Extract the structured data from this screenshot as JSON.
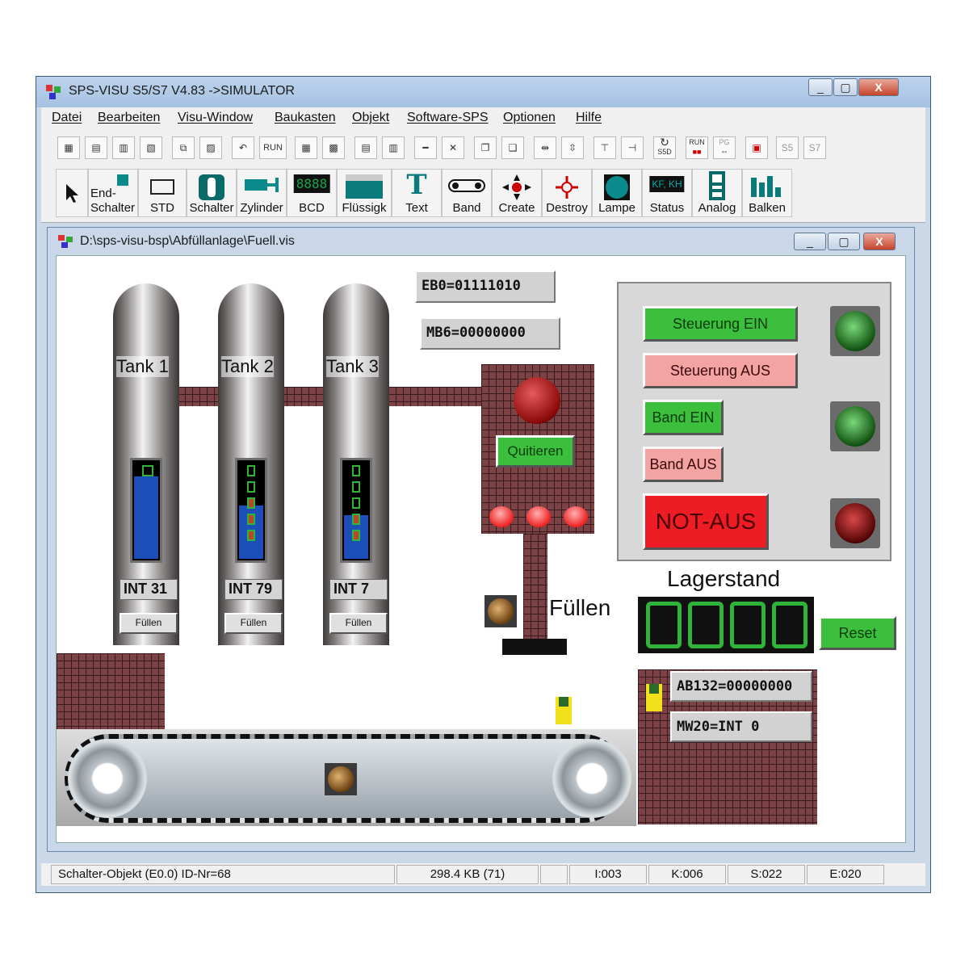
{
  "window": {
    "title": "SPS-VISU S5/S7 V4.83 ->SIMULATOR",
    "min": "▭",
    "max": "▢",
    "close": "X"
  },
  "menu": [
    "Datei",
    "Bearbeiten",
    "Visu-Window",
    "Baukasten",
    "Objekt",
    "Software-SPS",
    "Optionen",
    "Hilfe"
  ],
  "toolbar1": {
    "run": "RUN",
    "run2": "RUN",
    "pg": "PG",
    "s5": "S5",
    "s7": "S7",
    "s5d": "S5D"
  },
  "toolbar2": {
    "endschalter": [
      "End-",
      "Schalter"
    ],
    "std": "STD",
    "schalter": "Schalter",
    "zylinder": "Zylinder",
    "bcd": "BCD",
    "bcd_digits": "8888",
    "fluessigk": "Flüssigk",
    "text": "Text",
    "text_glyph": "T",
    "band": "Band",
    "create": "Create",
    "destroy": "Destroy",
    "lampe": "Lampe",
    "status": "Status",
    "status_glyph": "KF, KH",
    "analog": "Analog",
    "balken": "Balken"
  },
  "inner_window": {
    "title": "D:\\sps-visu-bsp\\Abfüllanlage\\Fuell.vis"
  },
  "tanks": [
    {
      "label": "Tank 1",
      "int": "INT 31",
      "button": "Füllen",
      "level": 0.85
    },
    {
      "label": "Tank 2",
      "int": "INT 79",
      "button": "Füllen",
      "level": 0.55
    },
    {
      "label": "Tank 3",
      "int": "INT 7",
      "button": "Füllen",
      "level": 0.45
    }
  ],
  "registers": {
    "eb0": "EB0=01111010",
    "mb6": "MB6=00000000",
    "ab132": "AB132=00000000",
    "mw20": "MW20=INT 0"
  },
  "quit_button": "Quitieren",
  "fill_label": "Füllen",
  "control": {
    "steuerung_ein": "Steuerung EIN",
    "steuerung_aus": "Steuerung AUS",
    "band_ein": "Band EIN",
    "band_aus": "Band AUS",
    "not_aus": "NOT-AUS"
  },
  "lagerstand": {
    "title": "Lagerstand",
    "reset": "Reset"
  },
  "statusbar": {
    "object": "Schalter-Objekt (E0.0) ID-Nr=68",
    "size": "298.4 KB (71)",
    "i": "I:003",
    "k": "K:006",
    "s": "S:022",
    "e": "E:020"
  },
  "colors": {
    "green_btn": "#3cbf3c",
    "pink_btn": "#f4a3a3",
    "red_btn": "#ee1c24",
    "brick": "#7c4346",
    "led_green": "#2fb33a"
  }
}
